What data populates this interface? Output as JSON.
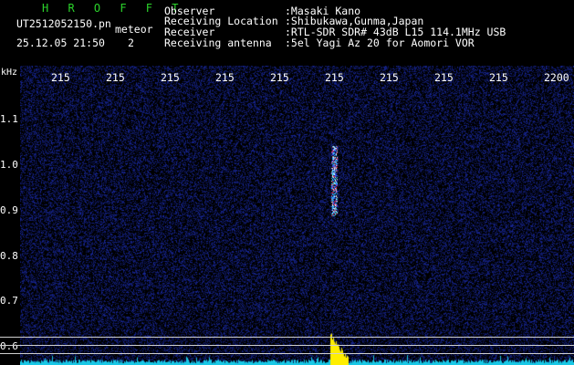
{
  "header": {
    "brand": "H R O F F T",
    "filename": "UT2512052150.pn",
    "mode": "meteor",
    "datetime": "25.12.05 21:50",
    "extra": "2",
    "fields": [
      {
        "label": "Observer",
        "value": ":Masaki Kano"
      },
      {
        "label": "Receiving Location",
        "value": ":Shibukawa,Gunma,Japan"
      },
      {
        "label": "Receiver",
        "value": ":RTL-SDR SDR# 43dB L15 114.1MHz USB"
      },
      {
        "label": "Receiving antenna",
        "value": ":5el Yagi Az 20 for Aomori VOR"
      }
    ]
  },
  "axis": {
    "y_unit": "kHz",
    "x_ticks": [
      "215",
      "215",
      "215",
      "215",
      "215",
      "215",
      "215",
      "215",
      "215",
      "2200"
    ],
    "y_ticks": [
      "1.1",
      "1.0",
      "0.9",
      "0.8",
      "0.7",
      "0.6"
    ]
  },
  "colors": {
    "background": "#000000",
    "noise": "#1c2a8a",
    "brand": "#2bd42b",
    "baseline_trace": "#19c8e6",
    "burst": "#ffee00"
  }
}
